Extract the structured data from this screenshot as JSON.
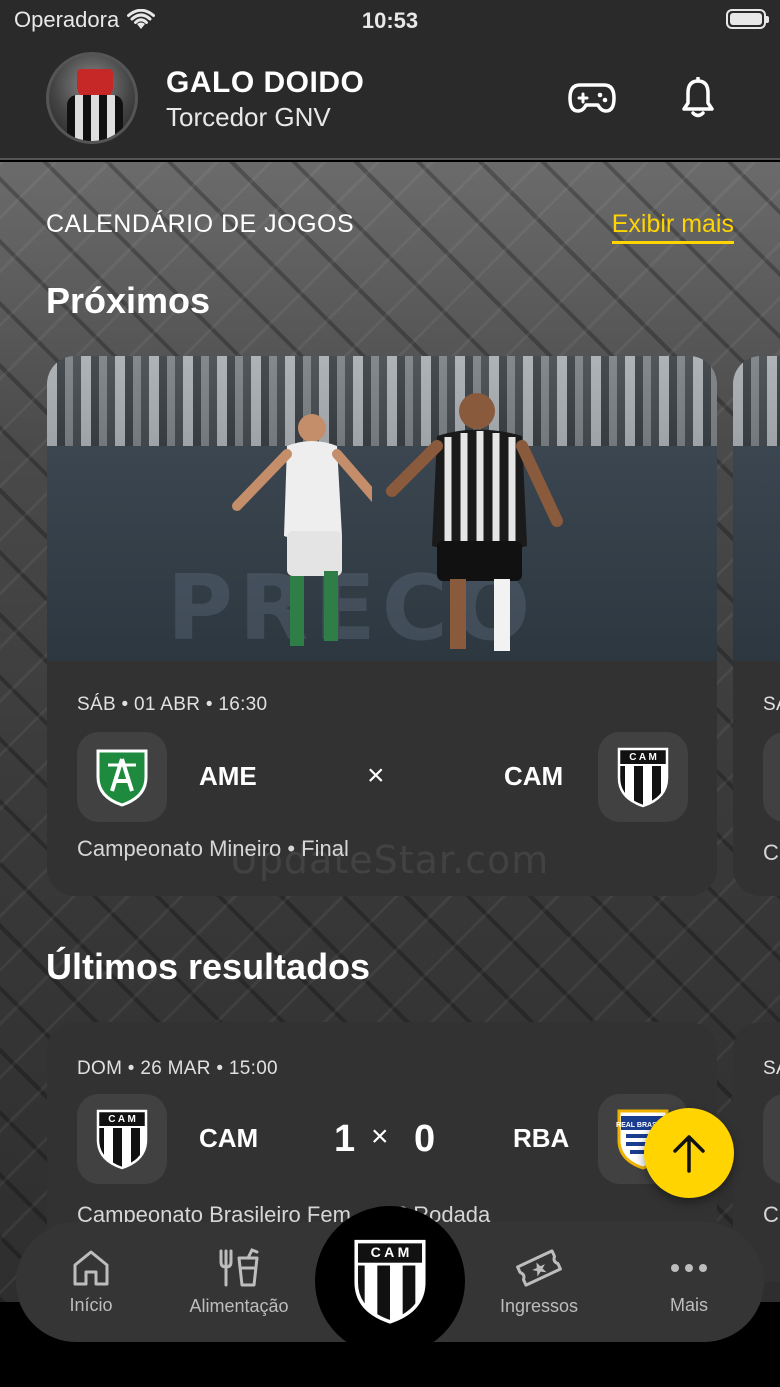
{
  "status_bar": {
    "carrier": "Operadora",
    "time": "10:53"
  },
  "header": {
    "user_name": "GALO DOIDO",
    "user_role": "Torcedor GNV",
    "icons": [
      "gamepad-icon",
      "bell-icon"
    ]
  },
  "calendar": {
    "title": "CALENDÁRIO DE JOGOS",
    "see_more": "Exibir mais",
    "upcoming_heading": "Próximos",
    "results_heading": "Últimos resultados"
  },
  "upcoming_match": {
    "date": "SÁB • 01 ABR • 16:30",
    "home_abbr": "AME",
    "away_abbr": "CAM",
    "separator": "×",
    "competition": "Campeonato Mineiro • Final",
    "photo_board_text": "PRECO"
  },
  "peek_card": {
    "date_start": "SÁ",
    "competition_start": "C"
  },
  "last_result": {
    "date": "DOM • 26 MAR • 15:00",
    "home_abbr": "CAM",
    "home_score": "1",
    "separator": "×",
    "away_score": "0",
    "away_abbr": "RBA",
    "competition": "Campeonato Brasileiro Fem",
    "round": "• 5ª Rodada",
    "away_badge_text": "REAL BRASÍLIA"
  },
  "watermark": "UpdateStar.com",
  "logo_text": "C A M",
  "tabs": [
    {
      "label": "Início",
      "icon": "home-icon"
    },
    {
      "label": "Alimentação",
      "icon": "food-drink-icon"
    },
    {
      "label": "Ingressos",
      "icon": "ticket-icon"
    },
    {
      "label": "Mais",
      "icon": "more-dots-icon"
    }
  ],
  "colors": {
    "accent": "#ffd400",
    "surface": "#2a2a2a",
    "card": "#323232"
  }
}
